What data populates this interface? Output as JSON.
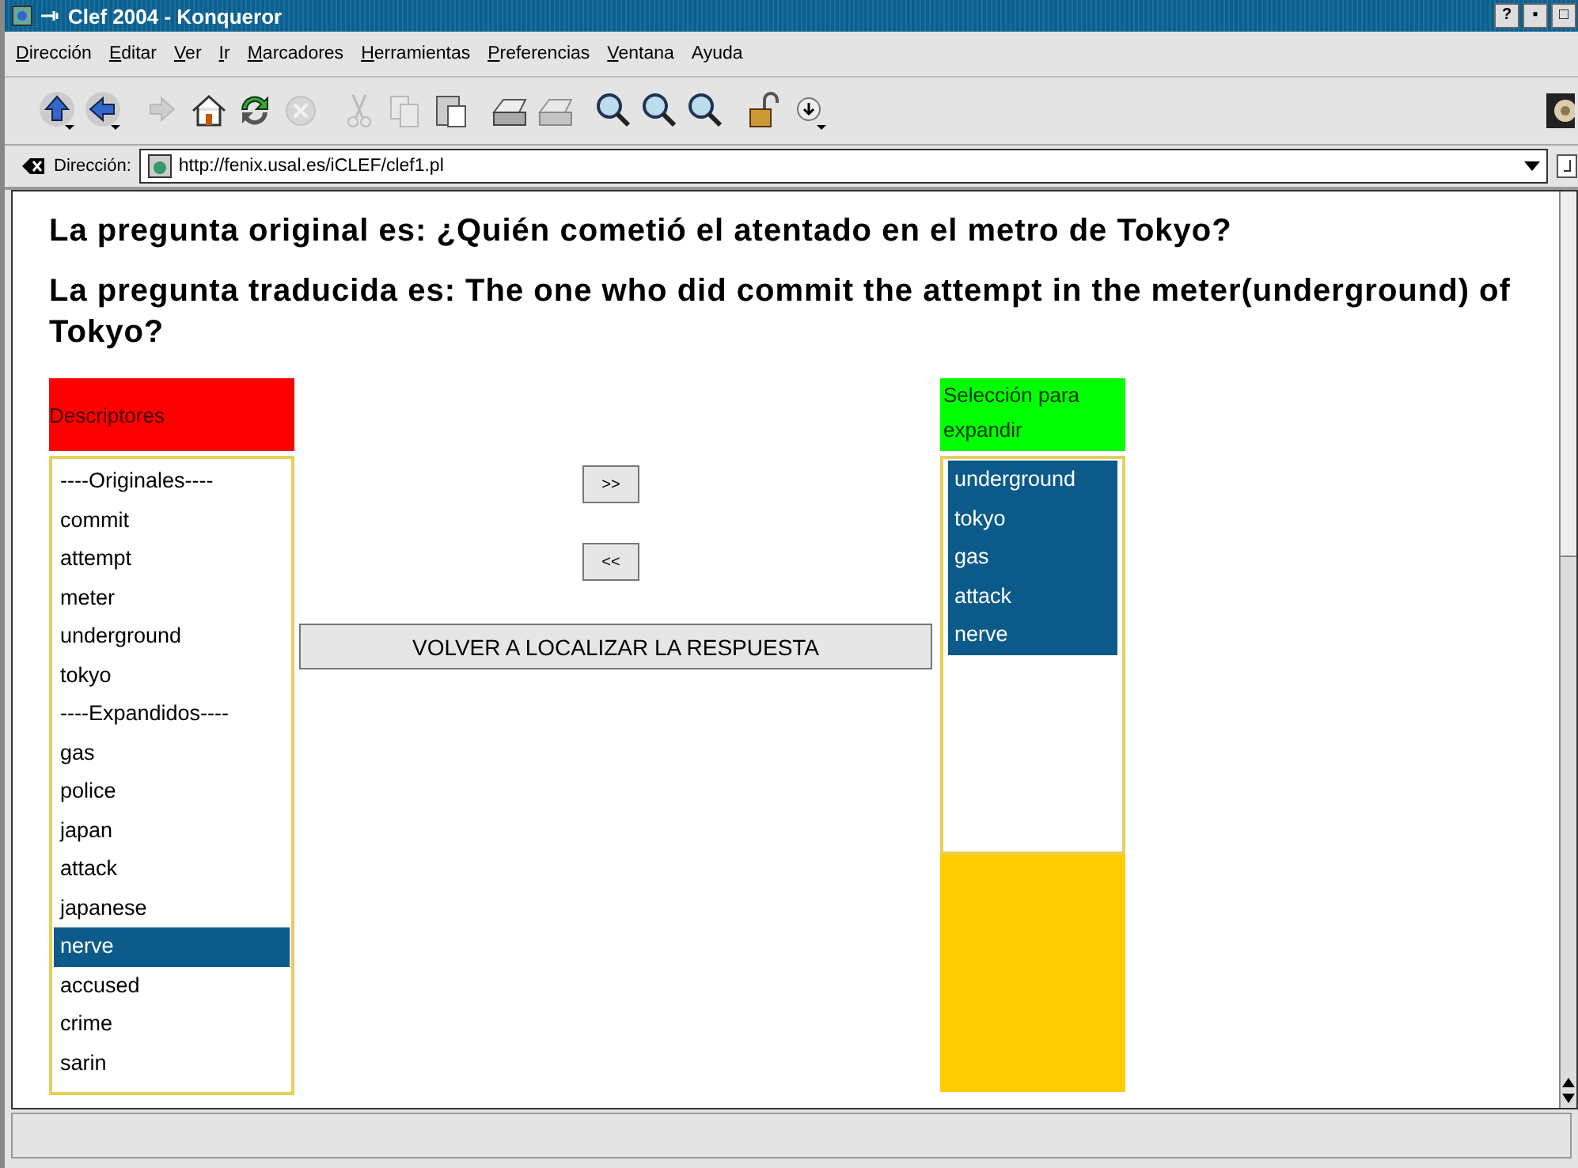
{
  "window": {
    "title": "Clef 2004 - Konqueror",
    "buttons": [
      "?",
      "▪",
      "□"
    ]
  },
  "menu": [
    {
      "label": "Dirección",
      "underlined": true
    },
    {
      "label": "Editar",
      "underlined": true
    },
    {
      "label": "Ver",
      "underlined": true
    },
    {
      "label": "Ir",
      "underlined": true
    },
    {
      "label": "Marcadores",
      "underlined": true
    },
    {
      "label": "Herramientas",
      "underlined": true
    },
    {
      "label": "Preferencias",
      "underlined": true
    },
    {
      "label": "Ventana",
      "underlined": true
    },
    {
      "label": "Ayuda",
      "underlined": false
    }
  ],
  "toolbar": [
    {
      "kind": "up",
      "disabled": false
    },
    {
      "kind": "back",
      "disabled": false
    },
    {
      "kind": "forward",
      "disabled": true
    },
    {
      "kind": "home",
      "disabled": false
    },
    {
      "kind": "reload",
      "disabled": false
    },
    {
      "kind": "stop",
      "disabled": true
    },
    {
      "kind": "cut",
      "disabled": true
    },
    {
      "kind": "copy",
      "disabled": true
    },
    {
      "kind": "paste",
      "disabled": false
    },
    {
      "kind": "print",
      "disabled": false
    },
    {
      "kind": "print",
      "disabled": true
    },
    {
      "kind": "zoom",
      "disabled": false
    },
    {
      "kind": "zoom",
      "disabled": false
    },
    {
      "kind": "zoom",
      "disabled": false
    },
    {
      "kind": "lock",
      "disabled": false
    },
    {
      "kind": "download",
      "disabled": false
    }
  ],
  "address": {
    "label": "Dirección:",
    "value": "http://fenix.usal.es/iCLEF/clef1.pl"
  },
  "page": {
    "question_original": "La pregunta original es: ¿Quién cometió el atentado en el metro de Tokyo?",
    "question_translated": "La pregunta traducida es: The one who did commit the attempt in the meter(underground) of Tokyo?",
    "descriptors": {
      "header": "Descriptores",
      "items": [
        {
          "label": "----Originales----",
          "selected": false
        },
        {
          "label": "commit",
          "selected": false
        },
        {
          "label": "attempt",
          "selected": false
        },
        {
          "label": "meter",
          "selected": false
        },
        {
          "label": "underground",
          "selected": false
        },
        {
          "label": "tokyo",
          "selected": false
        },
        {
          "label": "----Expandidos----",
          "selected": false
        },
        {
          "label": "gas",
          "selected": false
        },
        {
          "label": "police",
          "selected": false
        },
        {
          "label": "japan",
          "selected": false
        },
        {
          "label": "attack",
          "selected": false
        },
        {
          "label": "japanese",
          "selected": false
        },
        {
          "label": "nerve",
          "selected": true
        },
        {
          "label": "accused",
          "selected": false
        },
        {
          "label": "crime",
          "selected": false
        },
        {
          "label": "sarin",
          "selected": false
        }
      ]
    },
    "add_button": ">>",
    "remove_button": "<<",
    "relocate_button": "VOLVER A LOCALIZAR LA RESPUESTA",
    "selection": {
      "header": "Selección para expandir",
      "items": [
        {
          "label": "underground",
          "selected": true
        },
        {
          "label": "tokyo",
          "selected": true
        },
        {
          "label": "gas",
          "selected": true
        },
        {
          "label": "attack",
          "selected": true
        },
        {
          "label": "nerve",
          "selected": true
        }
      ]
    }
  }
}
